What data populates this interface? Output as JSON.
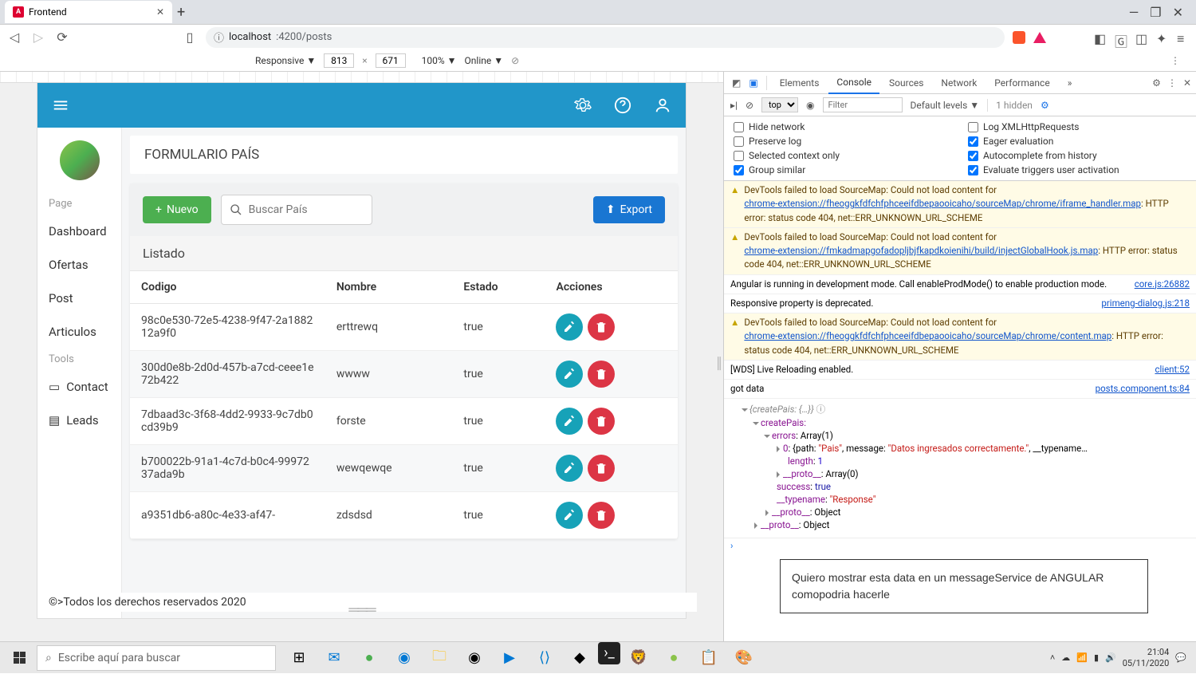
{
  "browser": {
    "tab_title": "Frontend",
    "url_prefix": "localhost",
    "url_suffix": ":4200/posts"
  },
  "device_bar": {
    "mode": "Responsive ▼",
    "width": "813",
    "height": "671",
    "zoom": "100% ▼",
    "online": "Online ▼"
  },
  "app": {
    "page_title": "FORMULARIO PAÍS",
    "btn_nuevo": "Nuevo",
    "btn_export": "Export",
    "search_placeholder": "Buscar País",
    "list_header": "Listado",
    "columns": {
      "codigo": "Codigo",
      "nombre": "Nombre",
      "estado": "Estado",
      "acciones": "Acciones"
    },
    "rows": [
      {
        "codigo": "98c0e530-72e5-4238-9f47-2a188212a9f0",
        "nombre": "erttrewq",
        "estado": "true"
      },
      {
        "codigo": "300d0e8b-2d0d-457b-a7cd-ceee1e72b422",
        "nombre": "wwww",
        "estado": "true"
      },
      {
        "codigo": "7dbaad3c-3f68-4dd2-9933-9c7db0cd39b9",
        "nombre": "forste",
        "estado": "true"
      },
      {
        "codigo": "b700022b-91a1-4c7d-b0c4-9997237ada9b",
        "nombre": "wewqewqe",
        "estado": "true"
      },
      {
        "codigo": "a9351db6-a80c-4e33-af47-",
        "nombre": "zdsdsd",
        "estado": "true"
      }
    ],
    "footer": "©>Todos los derechos reservados 2020",
    "sidebar": {
      "section_page": "Page",
      "dashboard": "Dashboard",
      "ofertas": "Ofertas",
      "post": "Post",
      "articulos": "Articulos",
      "section_tools": "Tools",
      "contact": "Contact",
      "leads": "Leads"
    }
  },
  "devtools": {
    "tabs": {
      "elements": "Elements",
      "console": "Console",
      "sources": "Sources",
      "network": "Network",
      "performance": "Performance"
    },
    "context": "top",
    "filter_placeholder": "Filter",
    "levels": "Default levels ▼",
    "hidden": "1 hidden",
    "options": {
      "hide_network": "Hide network",
      "preserve_log": "Preserve log",
      "selected_context": "Selected context only",
      "group_similar": "Group similar",
      "log_xhr": "Log XMLHttpRequests",
      "eager": "Eager evaluation",
      "autocomplete": "Autocomplete from history",
      "triggers": "Evaluate triggers user activation"
    },
    "logs": {
      "warn1_a": "DevTools failed to load SourceMap: Could not load content for ",
      "warn1_link": "chrome-extension://fheoggkfdfchfphceeifdbepaooicaho/sourceMap/chrome/iframe_handler.map",
      "warn1_b": ": HTTP error: status code 404, net::ERR_UNKNOWN_URL_SCHEME",
      "warn2_a": "DevTools failed to load SourceMap: Could not load content for ",
      "warn2_link": "chrome-extension://fmkadmapgofadopljbjfkapdkoienihi/build/injectGlobalHook.js.map",
      "warn2_b": ": HTTP error: status code 404, net::ERR_UNKNOWN_URL_SCHEME",
      "info1": "Angular is running in development mode. Call enableProdMode() to enable production mode.",
      "info1_src": "core.js:26882",
      "info2": "Responsive property is deprecated.",
      "info2_src": "primeng-dialog.js:218",
      "warn3_a": "DevTools failed to load SourceMap: Could not load content for ",
      "warn3_link": "chrome-extension://fheoggkfdfchfphceeifdbepaooicaho/sourceMap/chrome/content.map",
      "warn3_b": ": HTTP error: status code 404, net::ERR_UNKNOWN_URL_SCHEME",
      "info3": "[WDS] Live Reloading enabled.",
      "info3_src": "client:52",
      "gotdata": "got data",
      "gotdata_src": "posts.component.ts:84",
      "obj_root": "{createPais: {…}}",
      "obj_createPais": "createPais:",
      "obj_errors": "errors: Array(1)",
      "obj_item0": "0: {path: \"Pais\", message: \"Datos ingresados correctamente.\", __typename…",
      "obj_length": "length: 1",
      "obj_proto_arr": "__proto__: Array(0)",
      "obj_success": "success: true",
      "obj_typename": "__typename: \"Response\"",
      "obj_proto_obj1": "__proto__: Object",
      "obj_proto_obj2": "__proto__: Object"
    },
    "annotation": "Quiero mostrar esta data en un messageService de ANGULAR comopodria hacerle"
  },
  "taskbar": {
    "search_placeholder": "Escribe aquí para buscar",
    "time": "21:04",
    "date": "05/11/2020"
  }
}
